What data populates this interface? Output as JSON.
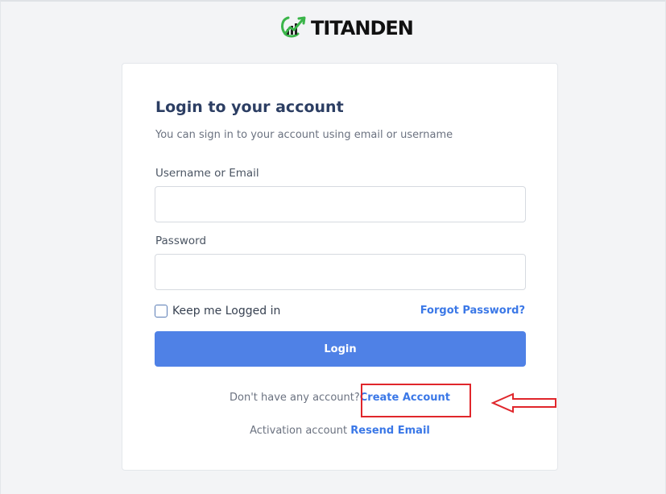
{
  "brand": {
    "logo_text": "TITANDEN",
    "logo_icon": "trend-chart-icon",
    "accent_color": "#3bb54a"
  },
  "login": {
    "title": "Login to your account",
    "subtitle": "You can sign in to your account using email or username",
    "username": {
      "label": "Username or Email",
      "value": "",
      "placeholder": ""
    },
    "password": {
      "label": "Password",
      "value": "",
      "placeholder": ""
    },
    "remember_label": "Keep me Logged in",
    "remember_checked": false,
    "forgot_label": "Forgot Password?",
    "submit_label": "Login",
    "submit_color": "#4f81e6",
    "link_color": "#3b78e7"
  },
  "footer": {
    "no_account_text": "Don't have any account?",
    "create_account_label": "Create Account",
    "activation_text": "Activation account",
    "resend_label": "Resend Email"
  },
  "annotation": {
    "highlight_color": "#e0262b",
    "arrow_icon": "left-arrow-icon"
  }
}
